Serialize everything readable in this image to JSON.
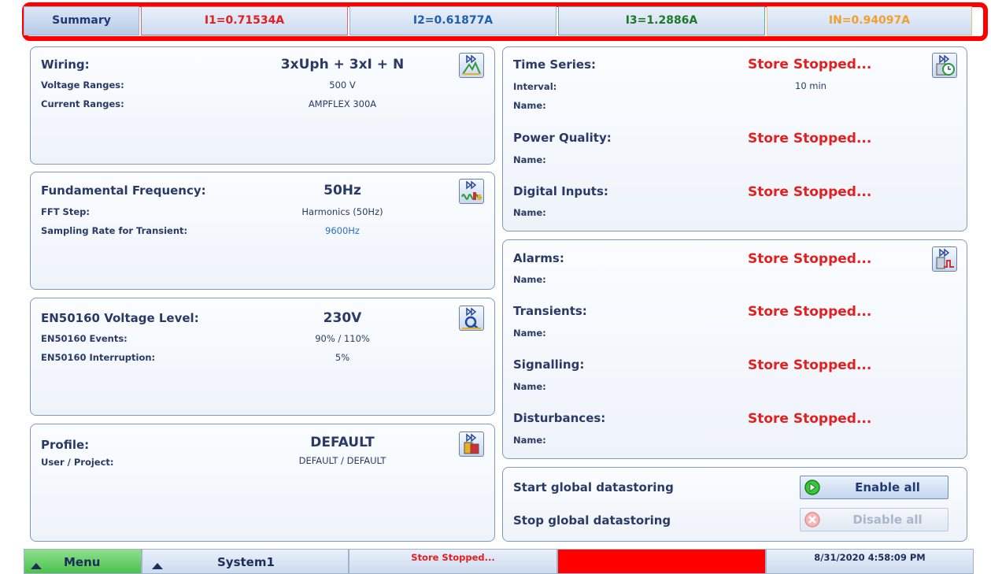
{
  "tabs": {
    "summary": "Summary",
    "i1": "I1=0.71534A",
    "i2": "I2=0.61877A",
    "i3": "I3=1.2886A",
    "in": "IN=0.94097A"
  },
  "wiring": {
    "title": "Wiring:",
    "value": "3xUph + 3xI + N",
    "voltage_label": "Voltage Ranges:",
    "voltage_value": "500 V",
    "current_label": "Current Ranges:",
    "current_value": "AMPFLEX 300A"
  },
  "frequency": {
    "title": "Fundamental Frequency:",
    "value": "50Hz",
    "fft_label": "FFT Step:",
    "fft_value": "Harmonics (50Hz)",
    "sampling_label": "Sampling Rate for Transient:",
    "sampling_value": "9600Hz"
  },
  "en50160": {
    "title": "EN50160 Voltage Level:",
    "value": "230V",
    "events_label": "EN50160 Events:",
    "events_value": "90% / 110%",
    "interruption_label": "EN50160 Interruption:",
    "interruption_value": "5%"
  },
  "profile": {
    "title": "Profile:",
    "value": "DEFAULT",
    "user_label": "User / Project:",
    "user_value": "DEFAULT / DEFAULT"
  },
  "timeseries": {
    "title": "Time Series:",
    "status": "Store Stopped...",
    "interval_label": "Interval:",
    "interval_value": "10 min",
    "name_label": "Name:"
  },
  "powerquality": {
    "title": "Power Quality:",
    "status": "Store Stopped...",
    "name_label": "Name:"
  },
  "digital": {
    "title": "Digital Inputs:",
    "status": "Store Stopped...",
    "name_label": "Name:"
  },
  "alarms": {
    "title": "Alarms:",
    "status": "Store Stopped...",
    "name_label": "Name:"
  },
  "transients": {
    "title": "Transients:",
    "status": "Store Stopped...",
    "name_label": "Name:"
  },
  "signalling": {
    "title": "Signalling:",
    "status": "Store Stopped...",
    "name_label": "Name:"
  },
  "disturbances": {
    "title": "Disturbances:",
    "status": "Store Stopped...",
    "name_label": "Name:"
  },
  "global": {
    "start_label": "Start global datastoring",
    "stop_label": "Stop global datastoring",
    "enable_label": "Enable all",
    "disable_label": "Disable all"
  },
  "bottom": {
    "menu": "Menu",
    "system": "System1",
    "status": "Store Stopped...",
    "datetime": "8/31/2020 4:58:09 PM"
  },
  "colors": {
    "stop_red": "#e41f1f",
    "alarm_bar": "#ff0000",
    "menu_green": "#6ad46a"
  }
}
